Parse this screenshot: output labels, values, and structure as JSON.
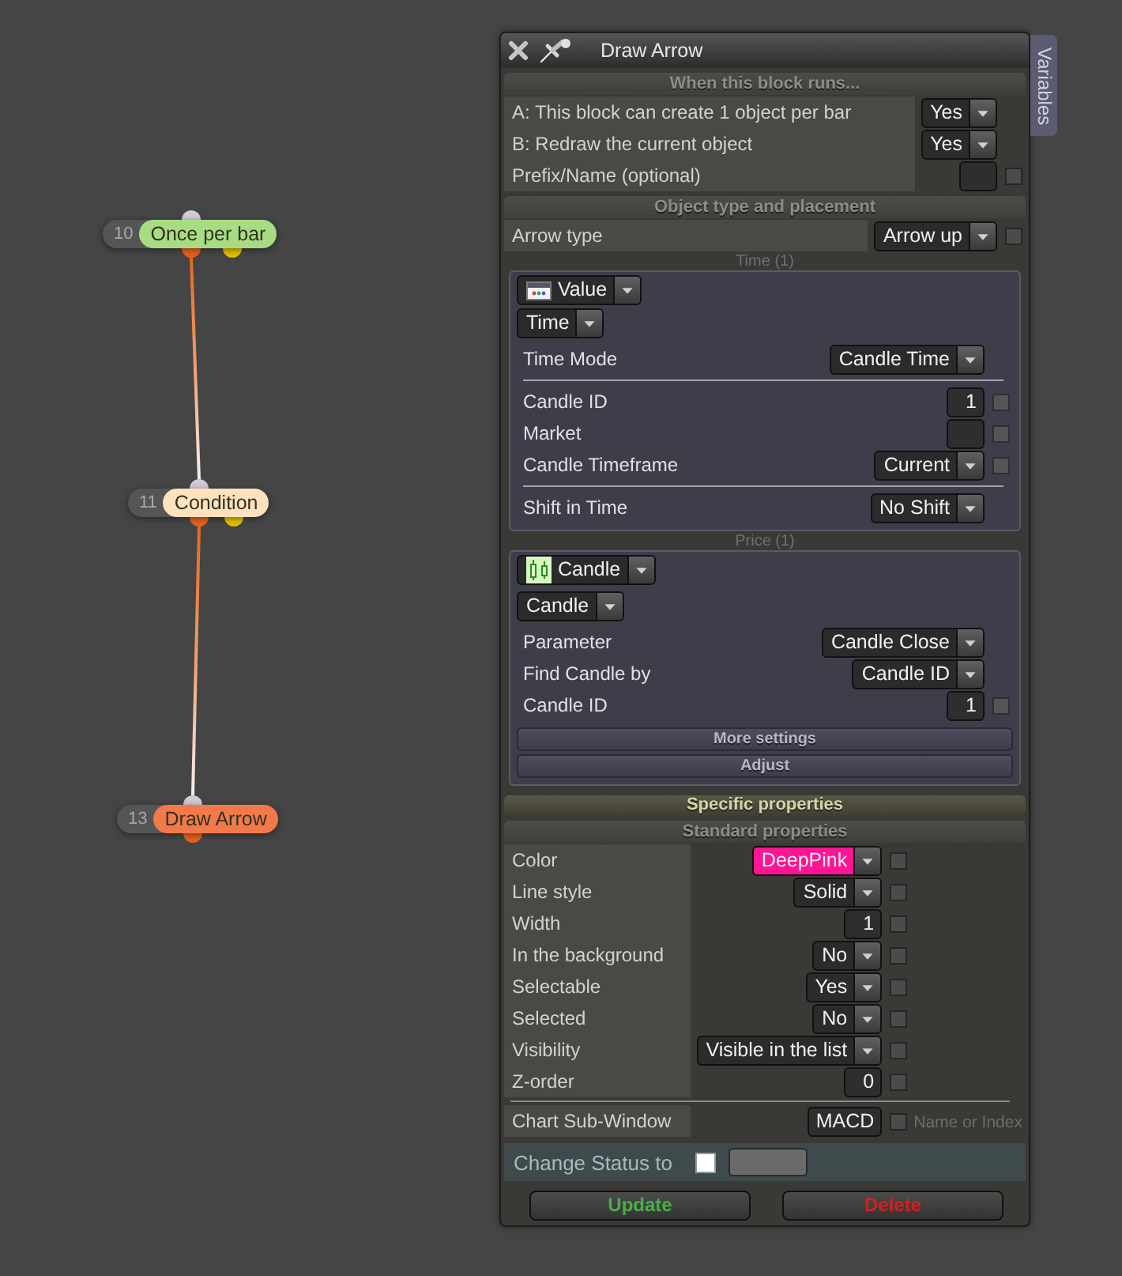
{
  "window": {
    "title": "Draw Arrow",
    "side_tab": "Variables"
  },
  "canvas": {
    "nodes": [
      {
        "number": "10",
        "label": "Once per bar",
        "color": "#a8dc82",
        "outputs": [
          {
            "color": "#e8621c"
          },
          {
            "color": "#e4c000"
          }
        ],
        "children": [
          {
            "number": "11",
            "label": "Condition",
            "color": "#fde2bd",
            "outputs": [
              {
                "color": "#e8621c"
              },
              {
                "color": "#e4c000"
              }
            ],
            "children": [
              {
                "number": "13",
                "label": "Draw Arrow",
                "color": "#f27a4a",
                "outputs": [
                  {
                    "color": "#e8621c"
                  }
                ]
              }
            ]
          }
        ]
      }
    ]
  },
  "blocks": [
    {
      "kind": "heading",
      "text": "When this block runs..."
    },
    {
      "kind": "fields",
      "rows": [
        {
          "kind": "field",
          "label": "A: This block can create 1 object per bar",
          "control": {
            "kind": "dropdown",
            "value": "Yes"
          }
        },
        {
          "kind": "field",
          "label": "B: Redraw the current object",
          "control": {
            "kind": "dropdown",
            "value": "Yes"
          }
        },
        {
          "kind": "field",
          "label": "Prefix/Name (optional)",
          "control": {
            "kind": "input"
          },
          "checkbox": {
            "checked": false
          }
        }
      ]
    },
    {
      "kind": "heading",
      "text": "Object type and placement"
    },
    {
      "kind": "fields",
      "rows": [
        {
          "kind": "field",
          "label": "Arrow type",
          "control": {
            "kind": "dropdown",
            "value": "Arrow up"
          },
          "checkbox": {
            "checked": false
          }
        }
      ]
    },
    {
      "kind": "group",
      "caption": "Time (1)",
      "source": {
        "kind": "value",
        "value": "Value"
      },
      "type": "Time",
      "rows": [
        {
          "kind": "field",
          "label": "Time Mode",
          "control": {
            "kind": "dropdown",
            "value": "Candle Time"
          }
        },
        {
          "kind": "divider"
        },
        {
          "kind": "field",
          "label": "Candle ID",
          "control": {
            "kind": "input",
            "value": "1"
          },
          "checkbox": {
            "checked": false
          }
        },
        {
          "kind": "field",
          "label": "Market",
          "control": {
            "kind": "input"
          },
          "checkbox": {
            "checked": false
          }
        },
        {
          "kind": "field",
          "label": "Candle Timeframe",
          "control": {
            "kind": "dropdown",
            "value": "Current"
          },
          "checkbox": {
            "checked": false
          }
        },
        {
          "kind": "divider"
        },
        {
          "kind": "field",
          "label": "Shift in Time",
          "control": {
            "kind": "dropdown",
            "value": "No Shift"
          }
        }
      ]
    },
    {
      "kind": "group",
      "caption": "Price (1)",
      "source": {
        "kind": "candle",
        "value": "Candle"
      },
      "type": "Candle",
      "rows": [
        {
          "kind": "field",
          "label": "Parameter",
          "control": {
            "kind": "dropdown",
            "value": "Candle Close"
          }
        },
        {
          "kind": "field",
          "label": "Find Candle by",
          "control": {
            "kind": "dropdown",
            "value": "Candle ID"
          }
        },
        {
          "kind": "field",
          "label": "Candle ID",
          "control": {
            "kind": "input",
            "value": "1"
          },
          "checkbox": {
            "checked": false
          }
        }
      ],
      "buttons": [
        "More settings",
        "Adjust"
      ]
    },
    {
      "kind": "bar",
      "text": "Specific properties"
    },
    {
      "kind": "heading",
      "text": "Standard properties"
    },
    {
      "kind": "fields",
      "rows": [
        {
          "kind": "field",
          "label": "Color",
          "control": {
            "kind": "dropdown",
            "value": "DeepPink",
            "color": "#ff1493"
          },
          "checkbox": {
            "checked": false
          }
        },
        {
          "kind": "field",
          "label": "Line style",
          "control": {
            "kind": "dropdown",
            "value": "Solid"
          },
          "checkbox": {
            "checked": false
          }
        },
        {
          "kind": "field",
          "label": "Width",
          "control": {
            "kind": "input",
            "value": "1"
          },
          "checkbox": {
            "checked": false
          }
        },
        {
          "kind": "field",
          "label": "In the background",
          "control": {
            "kind": "dropdown",
            "value": "No"
          },
          "checkbox": {
            "checked": false
          }
        },
        {
          "kind": "field",
          "label": "Selectable",
          "control": {
            "kind": "dropdown",
            "value": "Yes"
          },
          "checkbox": {
            "checked": false
          }
        },
        {
          "kind": "field",
          "label": "Selected",
          "control": {
            "kind": "dropdown",
            "value": "No"
          },
          "checkbox": {
            "checked": false
          }
        },
        {
          "kind": "field",
          "label": "Visibility",
          "control": {
            "kind": "dropdown",
            "value": "Visible in the list"
          },
          "checkbox": {
            "checked": false
          }
        },
        {
          "kind": "field",
          "label": "Z-order",
          "control": {
            "kind": "input",
            "value": "0"
          },
          "checkbox": {
            "checked": false
          }
        },
        {
          "kind": "divider"
        },
        {
          "kind": "field",
          "label": "Chart Sub-Window",
          "control": {
            "kind": "input",
            "value": "MACD"
          },
          "checkbox": {
            "checked": false
          },
          "hint": "Name or Index"
        }
      ]
    }
  ],
  "status": {
    "label": "Change Status to",
    "checked": false
  },
  "buttons": [
    {
      "kind": "update",
      "label": "Update"
    },
    {
      "kind": "delete",
      "label": "Delete"
    }
  ]
}
